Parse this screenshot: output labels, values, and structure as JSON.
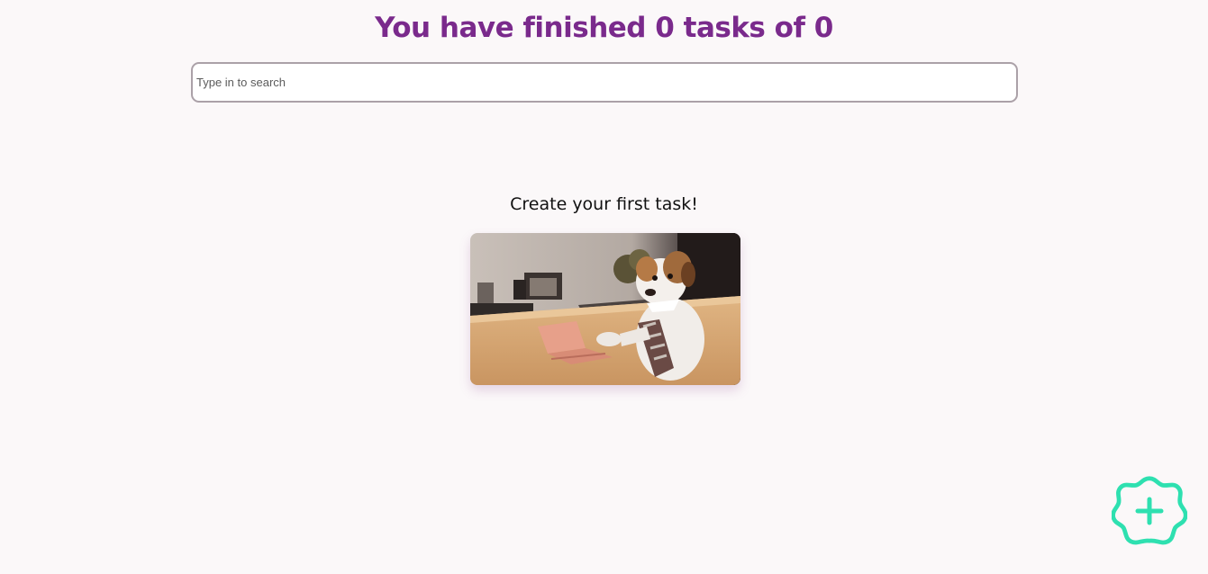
{
  "header": {
    "title": "You have finished 0 tasks of 0"
  },
  "search": {
    "placeholder": "Type in to search",
    "value": ""
  },
  "empty_state": {
    "heading": "Create your first task!",
    "image_icon": "dog-at-desk-gif"
  },
  "fab": {
    "icon": "plus-badge-icon",
    "color": "#2ee0b0"
  },
  "colors": {
    "title": "#7a2a8c",
    "background": "#fbf8f9",
    "accent": "#2ee0b0"
  }
}
